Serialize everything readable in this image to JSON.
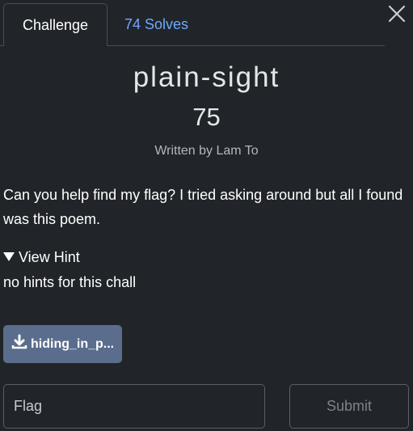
{
  "tabs": {
    "challenge_label": "Challenge",
    "solves_label": "74 Solves"
  },
  "challenge": {
    "name": "plain-sight",
    "points": "75",
    "author": "Written by Lam To",
    "description": "Can you help find my flag? I tried asking around but all I found was this poem."
  },
  "hint": {
    "toggle_label": "View Hint",
    "text": "no hints for this chall"
  },
  "file": {
    "label": "hiding_in_p..."
  },
  "submission": {
    "placeholder": "Flag",
    "value": "",
    "submit_label": "Submit"
  },
  "colors": {
    "background": "#212529",
    "accent_link": "#6ea8fe",
    "download_button": "#5a6d8c"
  },
  "icons": [
    "close-icon",
    "download-icon",
    "caret-down-icon"
  ]
}
